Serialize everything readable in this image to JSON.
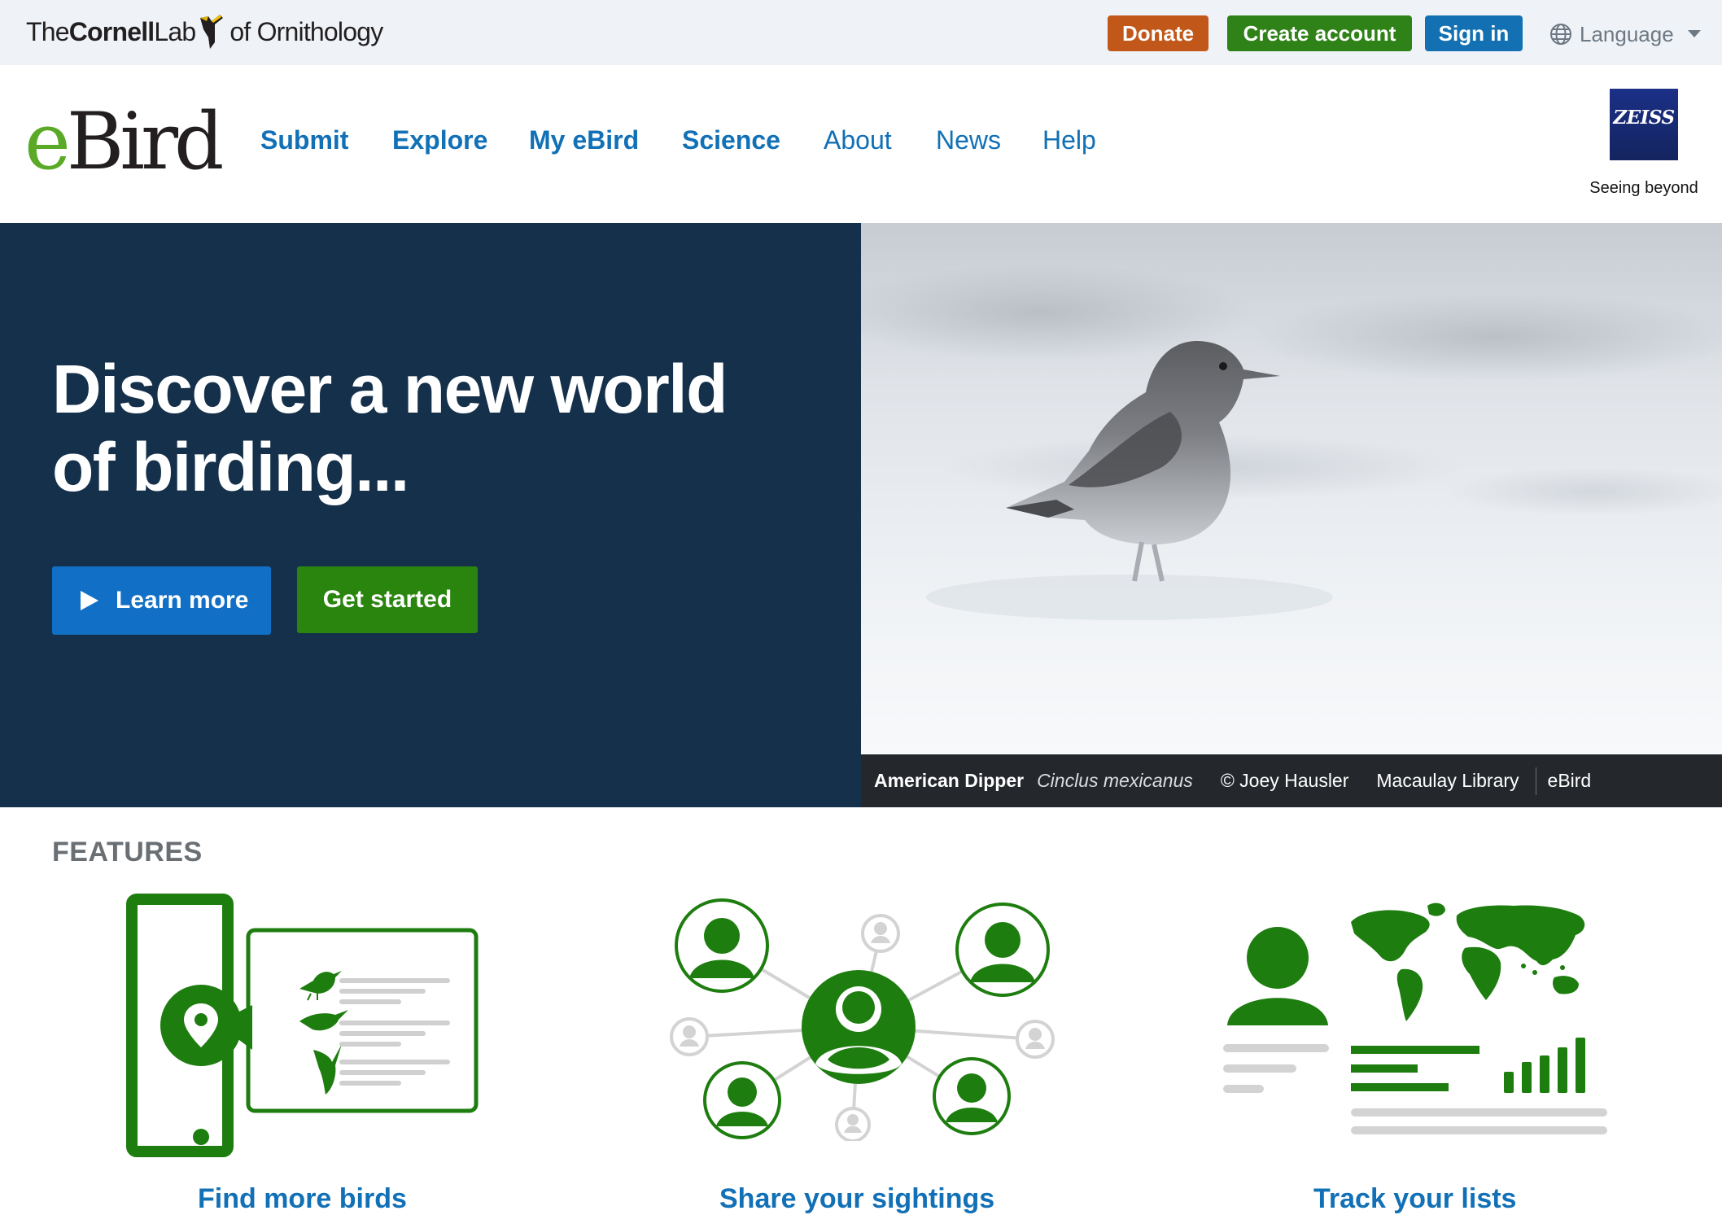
{
  "topbar": {
    "logo": {
      "the": "The",
      "cornell": "Cornell",
      "lab": "Lab",
      "of": "of Ornithology"
    },
    "donate": "Donate",
    "create_account": "Create account",
    "sign_in": "Sign in",
    "language": "Language"
  },
  "header": {
    "logo": {
      "e": "e",
      "bird": "Bird"
    },
    "nav": [
      "Submit",
      "Explore",
      "My eBird",
      "Science",
      "About",
      "News",
      "Help"
    ],
    "sponsor": {
      "name": "ZEISS",
      "tagline": "Seeing beyond"
    }
  },
  "hero": {
    "title": "Discover a new world of birding...",
    "learn_more": "Learn more",
    "get_started": "Get started",
    "caption": {
      "common_name": "American Dipper",
      "scientific_name": "Cinclus mexicanus",
      "credit": "© Joey Hausler",
      "library": "Macaulay Library",
      "source": "eBird"
    }
  },
  "features": {
    "heading": "FEATURES",
    "items": [
      "Find more birds",
      "Share your sightings",
      "Track your lists"
    ]
  },
  "colors": {
    "donate": "#c2571a",
    "create_account": "#2f8217",
    "sign_in": "#1371b3",
    "nav_link": "#1170b6",
    "hero_bg": "#15304a",
    "feature_green": "#1e7d0f",
    "feature_gray": "#d2d2d2"
  },
  "icons": [
    "language-globe-icon",
    "chevron-down-icon",
    "play-icon",
    "location-pin-icon",
    "bird-icon",
    "user-icon",
    "world-map-icon",
    "bar-chart-icon"
  ]
}
